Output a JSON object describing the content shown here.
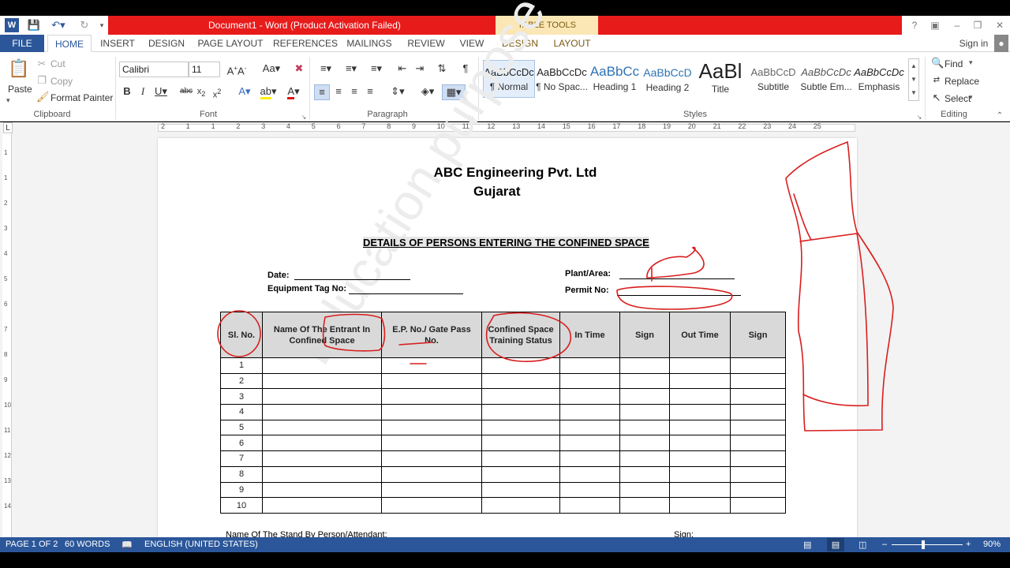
{
  "window": {
    "title": "Document1 -  Word (Product Activation Failed)",
    "context_tab_group": "TABLE TOOLS",
    "sign_in": "Sign in",
    "accent_color": "#2b579a",
    "title_band_color": "#e81b1b"
  },
  "tabs": [
    "FILE",
    "HOME",
    "INSERT",
    "DESIGN",
    "PAGE LAYOUT",
    "REFERENCES",
    "MAILINGS",
    "REVIEW",
    "VIEW",
    "DESIGN",
    "LAYOUT"
  ],
  "clipboard": {
    "paste": "Paste",
    "cut": "Cut",
    "copy": "Copy",
    "format_painter": "Format Painter",
    "label": "Clipboard"
  },
  "font": {
    "name": "Calibri",
    "size": "11",
    "label": "Font"
  },
  "paragraph": {
    "label": "Paragraph"
  },
  "styles": {
    "label": "Styles",
    "items": [
      {
        "preview": "AaBbCcDc",
        "name": "¶ Normal"
      },
      {
        "preview": "AaBbCcDc",
        "name": "¶ No Spac..."
      },
      {
        "preview": "AaBbCc",
        "name": "Heading 1"
      },
      {
        "preview": "AaBbCcD",
        "name": "Heading 2"
      },
      {
        "preview": "AaBl",
        "name": "Title"
      },
      {
        "preview": "AaBbCcD",
        "name": "Subtitle"
      },
      {
        "preview": "AaBbCcDc",
        "name": "Subtle Em..."
      },
      {
        "preview": "AaBbCcDc",
        "name": "Emphasis"
      }
    ]
  },
  "editing": {
    "find": "Find",
    "replace": "Replace",
    "select": "Select",
    "label": "Editing"
  },
  "ruler": {
    "numbers": [
      "2",
      "1",
      "1",
      "2",
      "3",
      "4",
      "5",
      "6",
      "7",
      "8",
      "9",
      "10",
      "11",
      "12",
      "13",
      "14",
      "15",
      "16",
      "17",
      "18",
      "19",
      "20",
      "21",
      "22",
      "23",
      "24",
      "25"
    ]
  },
  "document": {
    "company": "ABC Engineering Pvt. Ltd",
    "location": "Gujarat",
    "heading": "DETAILS OF PERSONS ENTERING THE CONFINED SPACE",
    "date_label": "Date:",
    "equipment_label": "Equipment  Tag No:",
    "plant_label": "Plant/Area:",
    "permit_label": "Permit No:",
    "watermark": "Education purpose only",
    "table_headers": [
      "Sl. No.",
      "Name Of The Entrant In Confined Space",
      "E.P. No./ Gate Pass No.",
      "Confined Space Training Status",
      "In Time",
      "Sign",
      "Out Time",
      "Sign"
    ],
    "rows": [
      "1",
      "2",
      "3",
      "4",
      "5",
      "6",
      "7",
      "8",
      "9",
      "10"
    ],
    "footer_left": "Name Of The Stand By Person/Attendant:",
    "footer_right": "Sign:"
  },
  "status": {
    "page": "PAGE 1 OF 2",
    "words": "60 WORDS",
    "language": "ENGLISH (UNITED STATES)",
    "zoom": "90%"
  }
}
